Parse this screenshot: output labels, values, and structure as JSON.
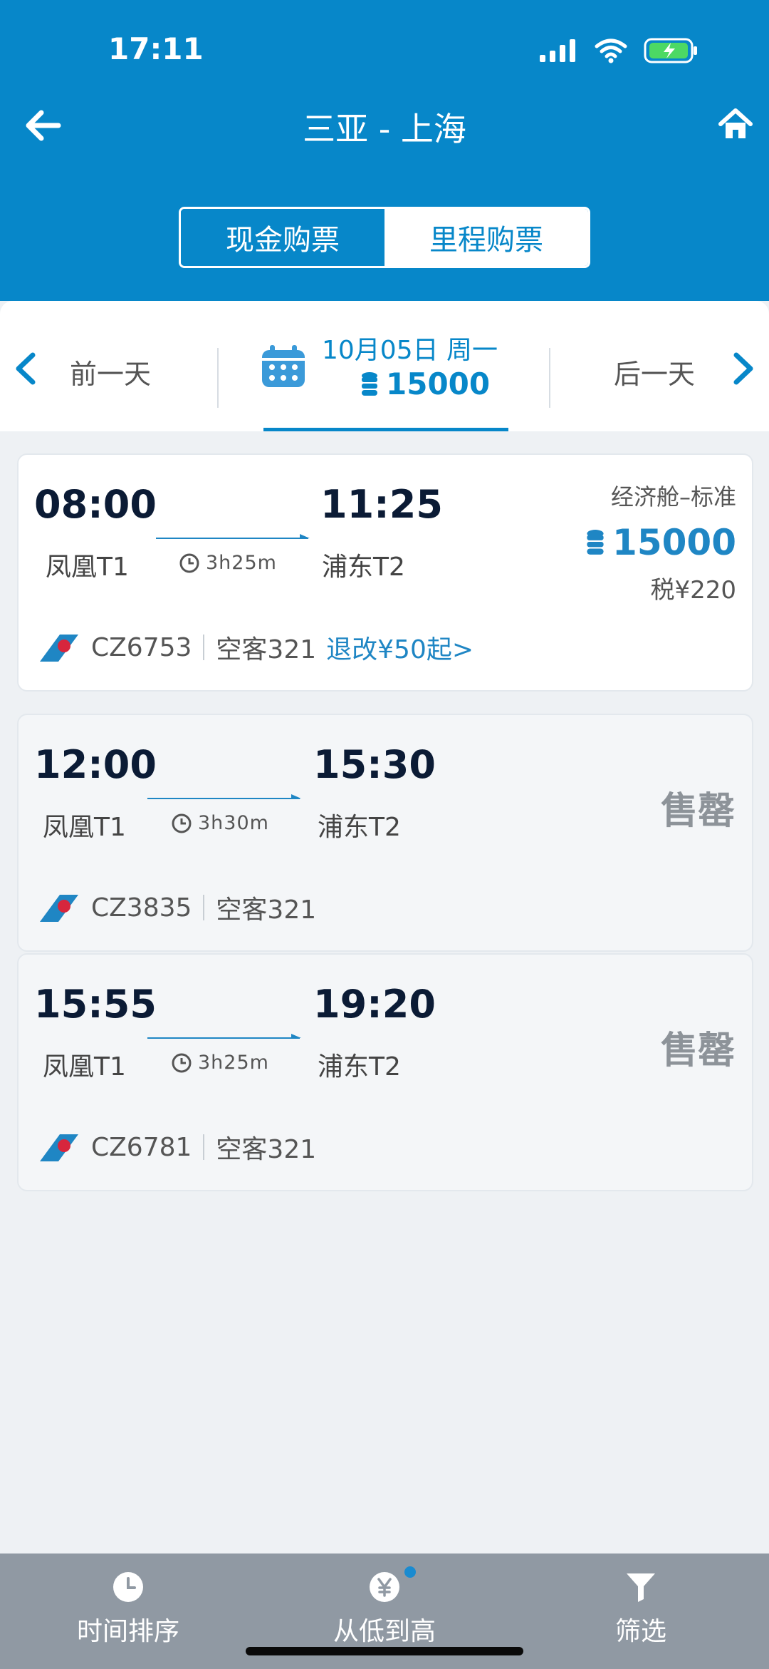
{
  "status": {
    "time": "17:11"
  },
  "header": {
    "title": "三亚 - 上海"
  },
  "segment": {
    "cash": "现金购票",
    "miles": "里程购票"
  },
  "datebar": {
    "prev": "前一天",
    "next": "后一天",
    "date": "10月05日 周一",
    "price": "15000"
  },
  "flights": [
    {
      "dep_time": "08:00",
      "arr_time": "11:25",
      "dep_term": "凤凰T1",
      "arr_term": "浦东T2",
      "duration": "3h25m",
      "flight_no": "CZ6753",
      "aircraft": "空客321",
      "change": "退改¥50起>",
      "cabin": "经济舱–标准",
      "miles": "15000",
      "tax": "税¥220",
      "status": "available"
    },
    {
      "dep_time": "12:00",
      "arr_time": "15:30",
      "dep_term": "凤凰T1",
      "arr_term": "浦东T2",
      "duration": "3h30m",
      "flight_no": "CZ3835",
      "aircraft": "空客321",
      "status_label": "售罄"
    },
    {
      "dep_time": "15:55",
      "arr_time": "19:20",
      "dep_term": "凤凰T1",
      "arr_term": "浦东T2",
      "duration": "3h25m",
      "flight_no": "CZ6781",
      "aircraft": "空客321",
      "status_label": "售罄"
    }
  ],
  "bottom": {
    "time_sort": "时间排序",
    "low_high": "从低到高",
    "filter": "筛选"
  },
  "colors": {
    "brand": "#0787c9",
    "accent": "#1f86c4",
    "soldout": "#8d9399"
  },
  "icons": [
    "back-arrow-icon",
    "home-icon",
    "calendar-icon",
    "coin-stack-icon",
    "clock-icon",
    "airline-logo-icon",
    "chevron-left-icon",
    "chevron-right-icon",
    "yen-icon",
    "filter-icon"
  ]
}
